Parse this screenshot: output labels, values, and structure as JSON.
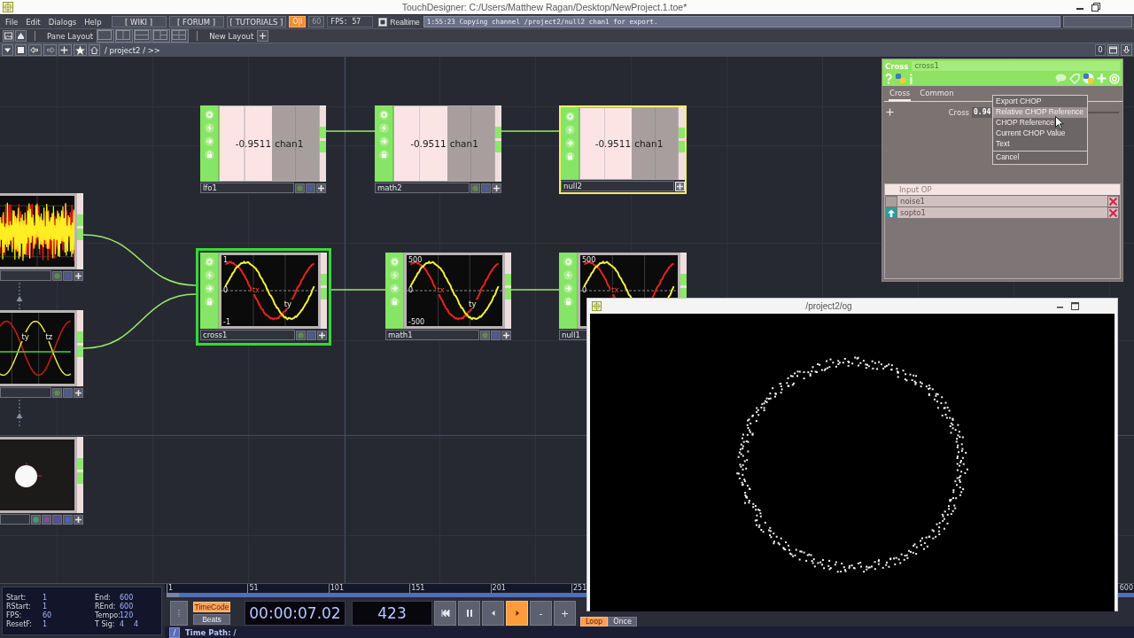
{
  "window": {
    "title": "TouchDesigner: C:/Users/Matthew Ragan/Desktop/NewProject.1.toe*"
  },
  "menu_bar": {
    "menus": [
      "File",
      "Edit",
      "Dialogs",
      "Help"
    ],
    "links": [
      "[ WIKI ]",
      "[ FORUM ]",
      "[ TUTORIALS ]"
    ],
    "play_toggle": {
      "label": "O|I",
      "on": true
    },
    "fps_limit": "60",
    "fps": "FPS: 57",
    "realtime": {
      "label": "Realtime",
      "checked": true
    },
    "status": "1:55:23 Copying channel /project2/null2 chan1 for export."
  },
  "pane_bar": {
    "label": "Pane Layout",
    "new_layout": "New Layout"
  },
  "path_bar": {
    "path": "/ project2 / >>",
    "counter": "0"
  },
  "nodes": [
    {
      "name": "lfo1",
      "kind": "value",
      "value": "-0.9511",
      "channel": "chan1",
      "selected": false,
      "current": false
    },
    {
      "name": "math2",
      "kind": "value",
      "value": "-0.9511",
      "channel": "chan1",
      "selected": false,
      "current": false
    },
    {
      "name": "null2",
      "kind": "value",
      "value": "-0.9511",
      "channel": "chan1",
      "selected": true,
      "current": false
    },
    {
      "name": "cross1",
      "kind": "graph",
      "axis_labels": [
        "1",
        "0",
        "-1"
      ],
      "channels": [
        "tx",
        "ty"
      ],
      "selected": false,
      "current": true
    },
    {
      "name": "math1",
      "kind": "graph",
      "axis_labels": [
        "500",
        "0",
        "-500"
      ],
      "channels": [
        "tx",
        "ty"
      ],
      "selected": false,
      "current": false
    },
    {
      "name": "null1",
      "kind": "graph",
      "axis_labels": [
        "500",
        "0"
      ],
      "channels": [
        "tx"
      ],
      "selected": false,
      "current": false
    },
    {
      "kind": "noise",
      "selected": false,
      "current": false
    },
    {
      "kind": "waves",
      "channels": [
        "ty",
        "tz"
      ],
      "selected": false,
      "current": false
    },
    {
      "kind": "sphere",
      "selected": false,
      "current": false
    }
  ],
  "parameters": {
    "type": "Cross",
    "name": "cross1",
    "tabs": [
      {
        "label": "Cross",
        "selected": true
      },
      {
        "label": "Common",
        "selected": false
      }
    ],
    "parameter": {
      "label": "Cross",
      "value": "0.94"
    },
    "menu": {
      "items": [
        {
          "label": "Export CHOP",
          "selected": false
        },
        {
          "label": "Relative CHOP Reference",
          "selected": true
        },
        {
          "label": "CHOP Reference",
          "selected": false
        },
        {
          "label": "Current CHOP Value",
          "selected": false
        },
        {
          "label": "Text",
          "selected": false
        }
      ],
      "cancel": "Cancel"
    },
    "input_table": {
      "header": "Input OP",
      "rows": [
        {
          "op": "noise1",
          "arrow": false
        },
        {
          "op": "sopto1",
          "arrow": true
        }
      ]
    }
  },
  "viewer": {
    "title": "/project2/og"
  },
  "timeline": {
    "info": [
      {
        "label": "Start:",
        "values": [
          "1"
        ]
      },
      {
        "label": "End:",
        "values": [
          "600"
        ]
      },
      {
        "label": "RStart:",
        "values": [
          "1"
        ]
      },
      {
        "label": "REnd:",
        "values": [
          "600"
        ]
      },
      {
        "label": "FPS:",
        "values": [
          "60"
        ]
      },
      {
        "label": "Tempo:",
        "values": [
          "120"
        ]
      },
      {
        "label": "ResetF:",
        "values": [
          "1"
        ]
      },
      {
        "label": "T Sig:",
        "values": [
          "4",
          "4"
        ]
      }
    ],
    "ruler": [
      "1",
      "51",
      "101",
      "151",
      "201",
      "251"
    ],
    "ruler_end": "600",
    "time_modes": [
      {
        "label": "TimeCode",
        "selected": true
      },
      {
        "label": "Beats",
        "selected": false
      }
    ],
    "timecode": "00:00:07.02",
    "frame": "423",
    "transport": [
      {
        "kind": "start",
        "selected": false
      },
      {
        "kind": "pause",
        "selected": false
      },
      {
        "kind": "back",
        "selected": false
      },
      {
        "kind": "play",
        "selected": true
      },
      {
        "kind": "text",
        "label": "-",
        "selected": false
      },
      {
        "kind": "text",
        "label": "+",
        "selected": false
      }
    ],
    "play_modes": [
      {
        "label": "Loop",
        "selected": true
      },
      {
        "label": "Once",
        "selected": false
      }
    ],
    "root_button": "/",
    "time_path": "Time Path: /"
  }
}
